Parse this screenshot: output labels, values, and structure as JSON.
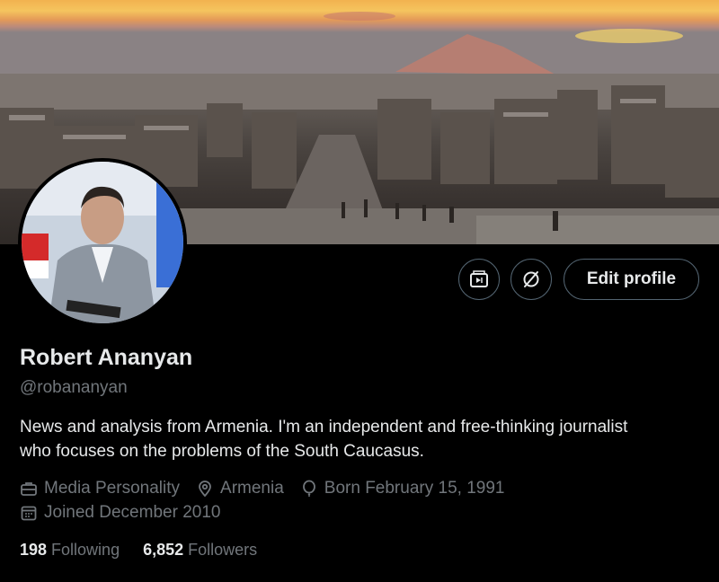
{
  "banner": {
    "description_icon": "cityscape-banner"
  },
  "avatar": {
    "icon": "profile-avatar"
  },
  "actions": {
    "media_icon": "media-icon",
    "grok_icon": "grok-icon",
    "edit_label": "Edit profile"
  },
  "profile": {
    "name": "Robert Ananyan",
    "handle": "@robananyan",
    "bio_line1": "News and analysis from Armenia. I'm an independent and free-thinking journalist",
    "bio_line2": "who focuses on the problems of the South Caucasus.",
    "category": "Media Personality",
    "location": "Armenia",
    "born": "Born February 15, 1991",
    "joined": "Joined December 2010"
  },
  "stats": {
    "following_count": "198",
    "following_label": "Following",
    "followers_count": "6,852",
    "followers_label": "Followers"
  },
  "colors": {
    "text": "#e7e9ea",
    "muted": "#71767b",
    "border": "#536471",
    "bg": "#000000"
  }
}
